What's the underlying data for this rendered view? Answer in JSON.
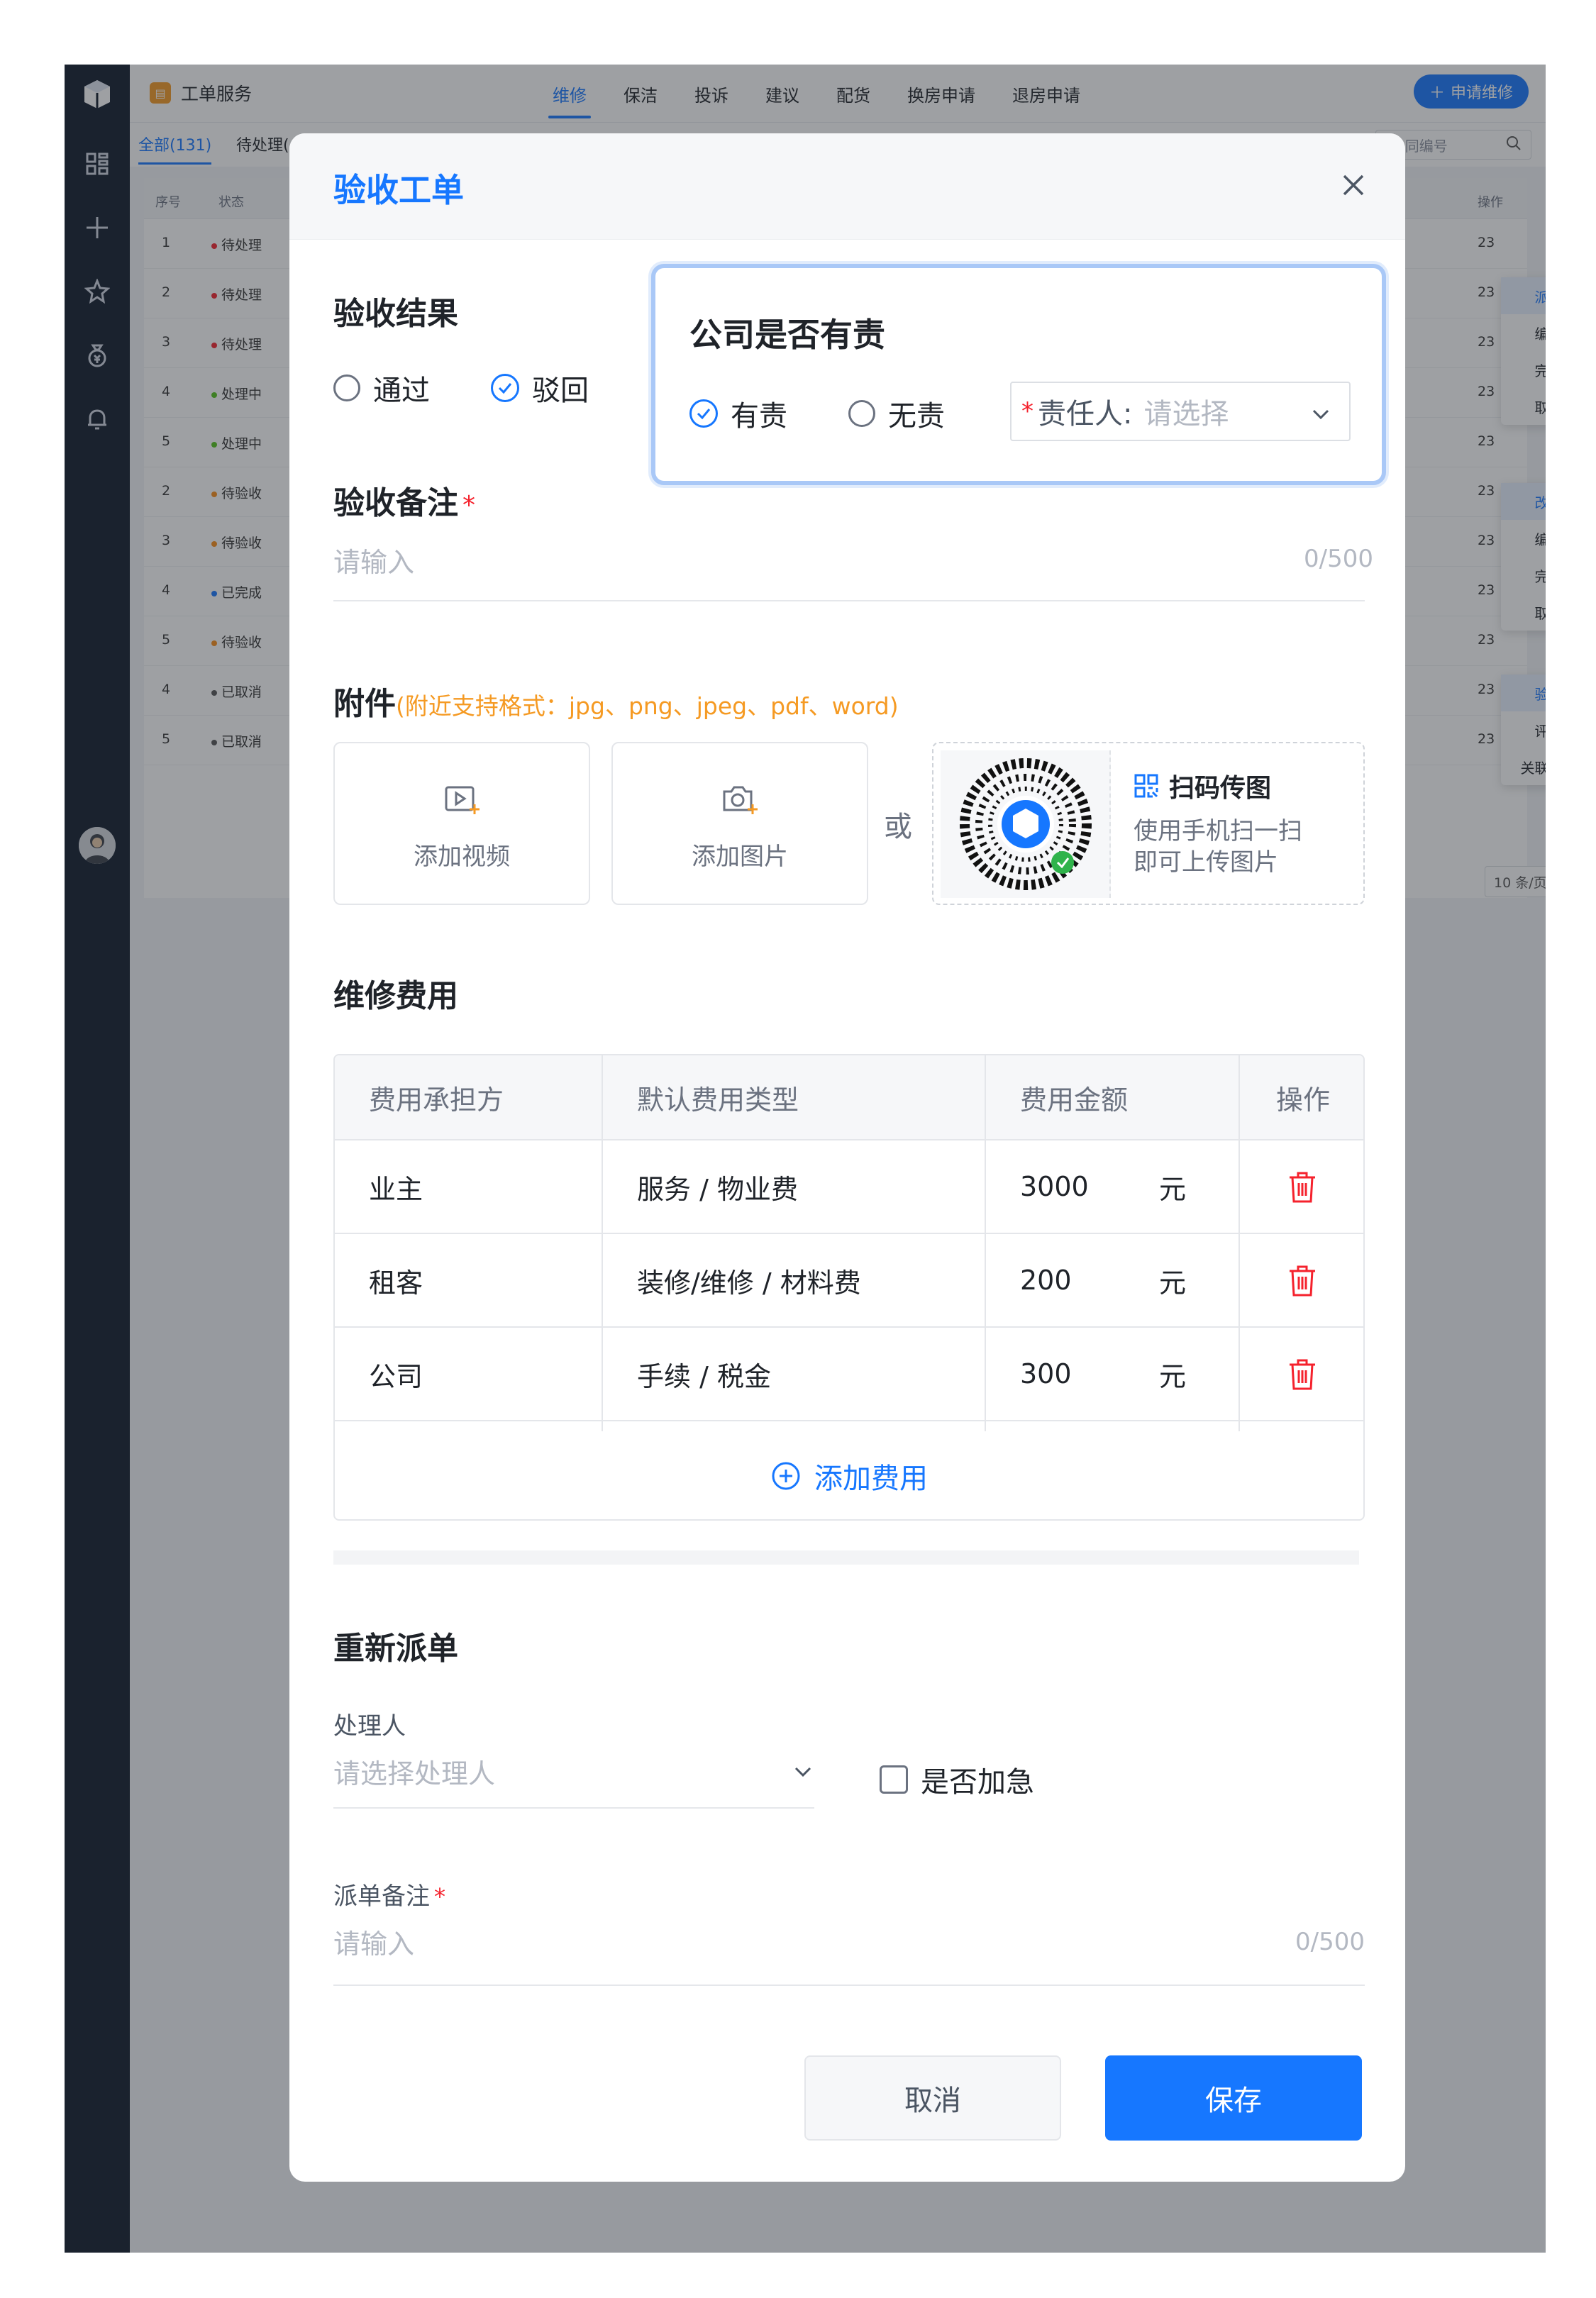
{
  "app": {
    "brand": "工单服务",
    "tabs": [
      "维修",
      "保洁",
      "投诉",
      "建议",
      "配货",
      "换房申请",
      "退房申请"
    ],
    "active_tab": 0,
    "apply_button": "申请维修",
    "subtabs": [
      "全部(131)",
      "待处理("
    ],
    "search_placeholder": "/合同编号",
    "table_headers": {
      "no": "序号",
      "status": "状态",
      "op": "操作"
    },
    "rows": [
      {
        "no": "1",
        "status": "待处理",
        "color": "#f5222d"
      },
      {
        "no": "2",
        "status": "待处理",
        "color": "#f5222d"
      },
      {
        "no": "3",
        "status": "待处理",
        "color": "#f5222d"
      },
      {
        "no": "4",
        "status": "处理中",
        "color": "#52c41a"
      },
      {
        "no": "5",
        "status": "处理中",
        "color": "#52c41a"
      },
      {
        "no": "2",
        "status": "待验收",
        "color": "#fa8c16"
      },
      {
        "no": "3",
        "status": "待验收",
        "color": "#fa8c16"
      },
      {
        "no": "4",
        "status": "已完成",
        "color": "#1677ff"
      },
      {
        "no": "5",
        "status": "待验收",
        "color": "#fa8c16"
      },
      {
        "no": "4",
        "status": "已取消",
        "color": "#555555"
      },
      {
        "no": "5",
        "status": "已取消",
        "color": "#555555"
      }
    ],
    "row_tail": "23",
    "menus": [
      [
        "派单",
        "编辑",
        "完成",
        "取消"
      ],
      [
        "改派",
        "编辑",
        "完成",
        "取消"
      ],
      [
        "验收",
        "评价",
        "关联房源"
      ]
    ],
    "pager": "10 条/页"
  },
  "modal": {
    "title": "验收工单",
    "result": {
      "label": "验收结果",
      "options": [
        "通过",
        "驳回"
      ],
      "selected": 1
    },
    "remark": {
      "label": "验收备注",
      "required": "*",
      "placeholder": "请输入",
      "count": "0/500"
    },
    "attachment": {
      "label": "附件",
      "note": "(附近支持格式：jpg、png、jpeg、pdf、word)",
      "add_video": "添加视频",
      "add_image": "添加图片",
      "or": "或",
      "qr_title": "扫码传图",
      "qr_line1": "使用手机扫一扫",
      "qr_line2": "即可上传图片"
    },
    "fees": {
      "label": "维修费用",
      "headers": [
        "费用承担方",
        "默认费用类型",
        "费用金额",
        "操作"
      ],
      "rows": [
        {
          "payer": "业主",
          "type": "服务 / 物业费",
          "amount": "3000",
          "unit": "元"
        },
        {
          "payer": "租客",
          "type": "装修/维修 / 材料费",
          "amount": "200",
          "unit": "元"
        },
        {
          "payer": "公司",
          "type": "手续 / 税金",
          "amount": "300",
          "unit": "元"
        }
      ],
      "add_label": "添加费用"
    },
    "redispatch": {
      "label": "重新派单",
      "handler_label": "处理人",
      "handler_placeholder": "请选择处理人",
      "urgent_label": "是否加急",
      "remark_label": "派单备注",
      "required": "*",
      "remark_placeholder": "请输入",
      "remark_count": "0/500"
    },
    "cancel": "取消",
    "save": "保存"
  },
  "popup": {
    "title": "公司是否有责",
    "options": [
      "有责",
      "无责"
    ],
    "selected": 0,
    "required": "*",
    "select_label": "责任人:",
    "select_placeholder": "请选择"
  },
  "colors": {
    "primary": "#1677ff",
    "danger": "#f5222d",
    "warning": "#f59a23",
    "sidebar": "#0f1a2b"
  }
}
